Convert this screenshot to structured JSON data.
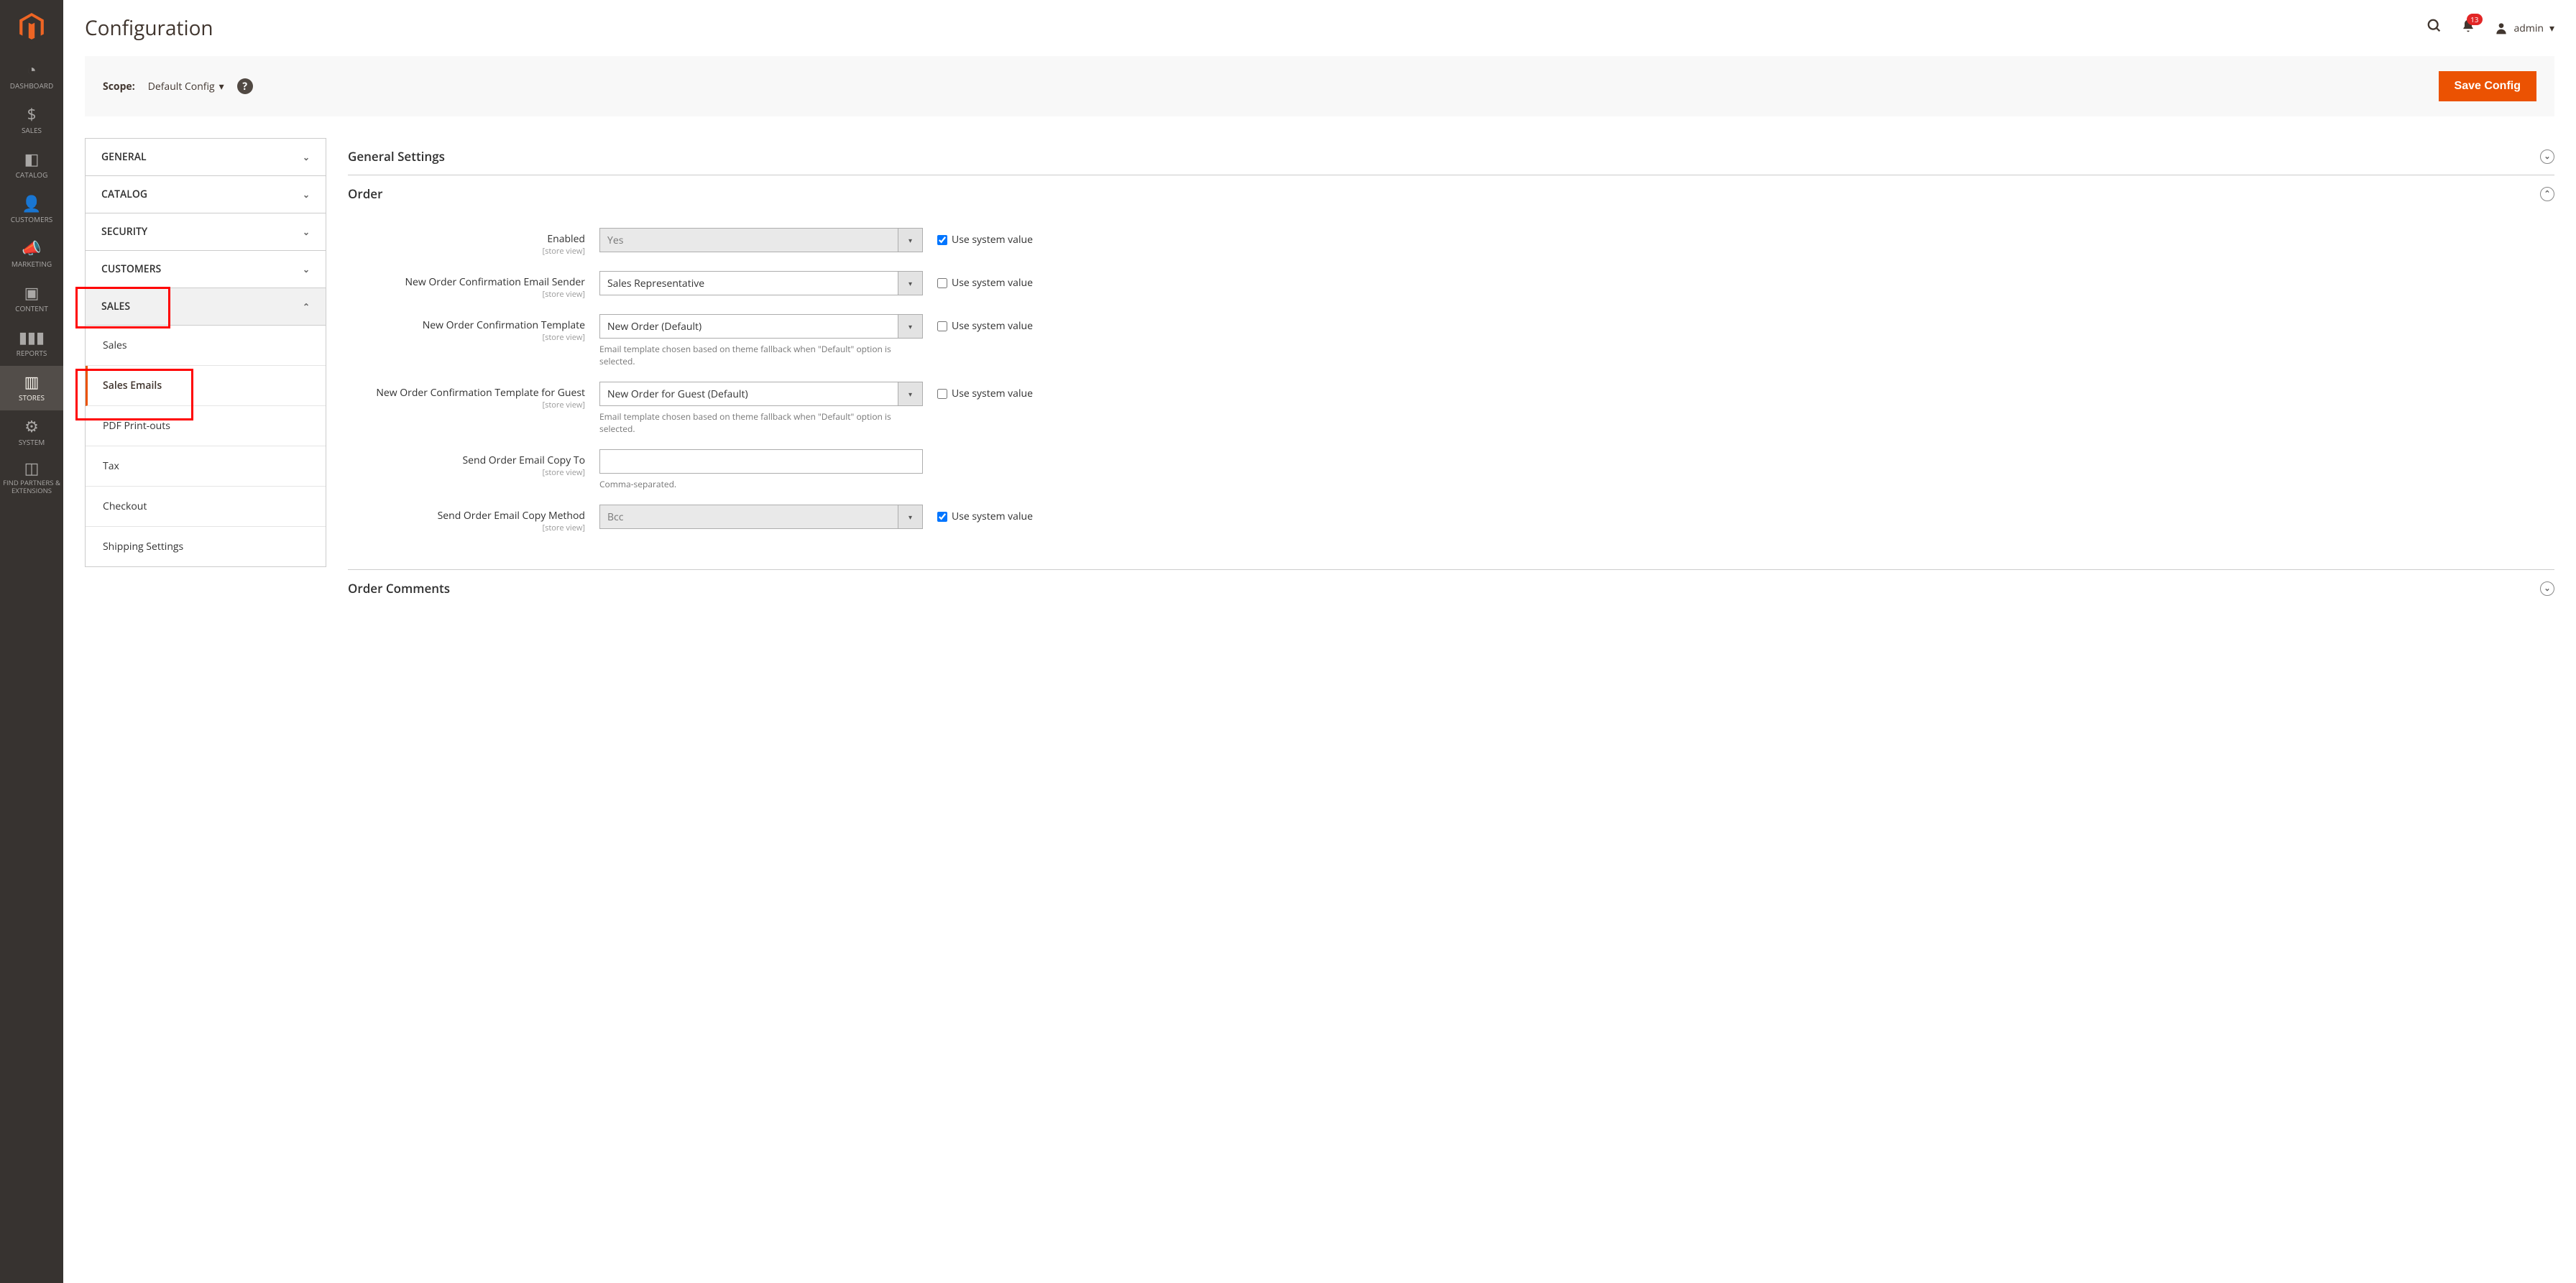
{
  "sidebar": {
    "items": [
      {
        "label": "DASHBOARD",
        "icon": "dashboard"
      },
      {
        "label": "SALES",
        "icon": "sales"
      },
      {
        "label": "CATALOG",
        "icon": "catalog"
      },
      {
        "label": "CUSTOMERS",
        "icon": "customers"
      },
      {
        "label": "MARKETING",
        "icon": "marketing"
      },
      {
        "label": "CONTENT",
        "icon": "content"
      },
      {
        "label": "REPORTS",
        "icon": "reports"
      },
      {
        "label": "STORES",
        "icon": "stores",
        "active": true
      },
      {
        "label": "SYSTEM",
        "icon": "system"
      },
      {
        "label": "FIND PARTNERS\n& EXTENSIONS",
        "icon": "partners"
      }
    ]
  },
  "header": {
    "title": "Configuration",
    "notifications": "13",
    "user": "admin"
  },
  "scope": {
    "label": "Scope:",
    "value": "Default Config",
    "save": "Save Config"
  },
  "configNav": {
    "groups": [
      "GENERAL",
      "CATALOG",
      "SECURITY",
      "CUSTOMERS",
      "SALES"
    ],
    "salesSubs": [
      "Sales",
      "Sales Emails",
      "PDF Print-outs",
      "Tax",
      "Checkout",
      "Shipping Settings"
    ]
  },
  "sections": {
    "general": "General Settings",
    "order": "Order",
    "comments": "Order Comments"
  },
  "fields": {
    "enabled": {
      "label": "Enabled",
      "scope": "[store view]",
      "value": "Yes",
      "use_system": true
    },
    "sender": {
      "label": "New Order Confirmation Email Sender",
      "scope": "[store view]",
      "value": "Sales Representative",
      "use_system": false
    },
    "template": {
      "label": "New Order Confirmation Template",
      "scope": "[store view]",
      "value": "New Order (Default)",
      "use_system": false,
      "note": "Email template chosen based on theme fallback when \"Default\" option is selected."
    },
    "template_guest": {
      "label": "New Order Confirmation Template for Guest",
      "scope": "[store view]",
      "value": "New Order for Guest (Default)",
      "use_system": false,
      "note": "Email template chosen based on theme fallback when \"Default\" option is selected."
    },
    "copy_to": {
      "label": "Send Order Email Copy To",
      "scope": "[store view]",
      "value": "",
      "note": "Comma-separated."
    },
    "copy_method": {
      "label": "Send Order Email Copy Method",
      "scope": "[store view]",
      "value": "Bcc",
      "use_system": true
    },
    "use_system_label": "Use system value"
  }
}
